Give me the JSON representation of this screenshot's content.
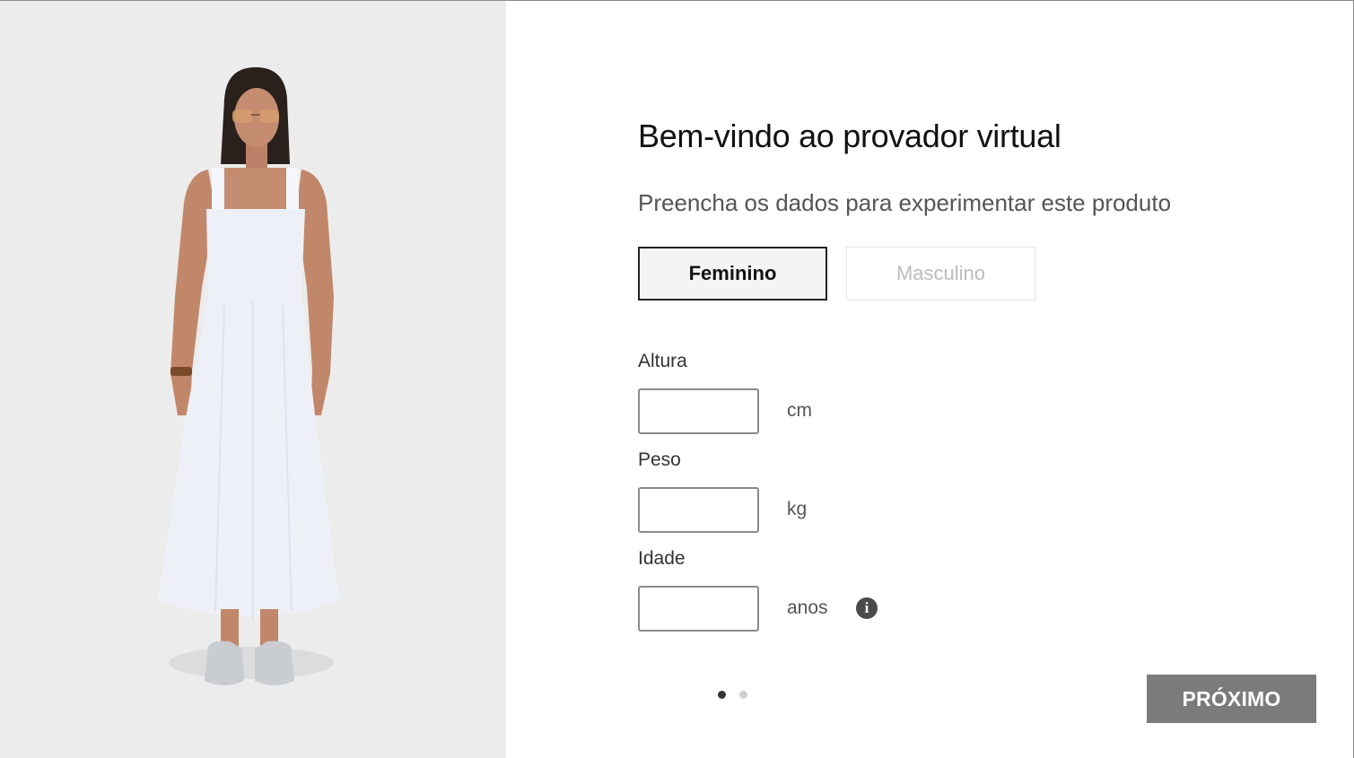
{
  "product_image": {
    "subject": "Model wearing white midi dress",
    "background_color": "#ececec"
  },
  "header": {
    "title": "Bem-vindo ao provador virtual",
    "subtitle": "Preencha os dados para experimentar este produto"
  },
  "gender": {
    "options": [
      "Feminino",
      "Masculino"
    ],
    "selected": "Feminino"
  },
  "fields": [
    {
      "label": "Altura",
      "value": "",
      "unit": "cm"
    },
    {
      "label": "Peso",
      "value": "",
      "unit": "kg"
    },
    {
      "label": "Idade",
      "value": "",
      "unit": "anos",
      "info_icon": "info-icon"
    }
  ],
  "pagination": {
    "current": 1,
    "total": 2
  },
  "next_button": {
    "label": "PRÓXIMO",
    "color": "#7b7b7b"
  }
}
